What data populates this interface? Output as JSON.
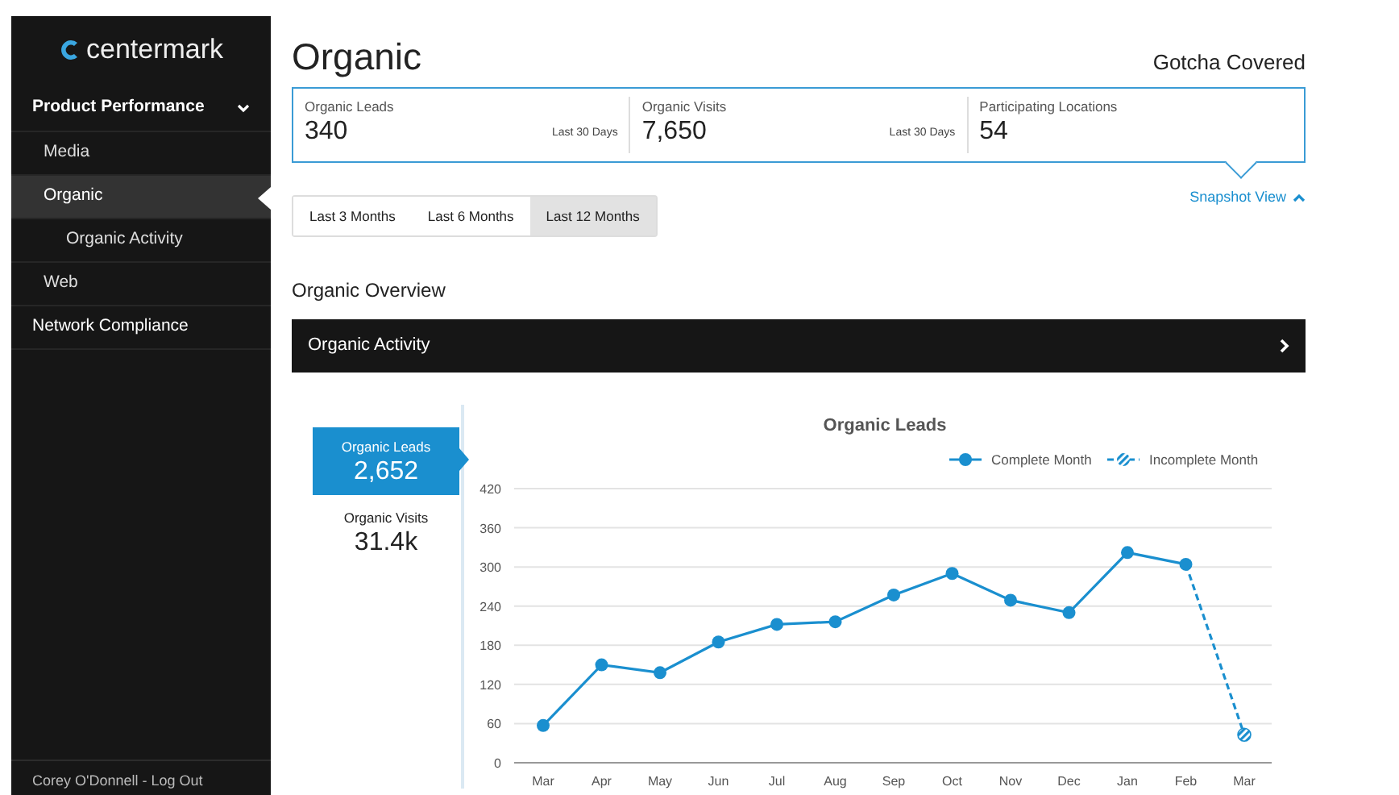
{
  "sidebar": {
    "logo": "centermark",
    "items": [
      {
        "label": "Product Performance",
        "expanded": true,
        "selected": false,
        "children": [
          {
            "label": "Media",
            "selected": false
          },
          {
            "label": "Organic",
            "selected": true,
            "children": [
              {
                "label": "Organic Activity",
                "selected": false
              }
            ]
          },
          {
            "label": "Web",
            "selected": false
          }
        ]
      },
      {
        "label": "Network Compliance",
        "selected": false
      }
    ],
    "user": "Corey O'Donnell - Log Out"
  },
  "page": {
    "title": "Organic",
    "account": "Gotcha Covered"
  },
  "metrics": [
    {
      "label": "Organic Leads",
      "value": "340",
      "period": "Last 30 Days"
    },
    {
      "label": "Organic Visits",
      "value": "7,650",
      "period": "Last 30 Days"
    },
    {
      "label": "Participating Locations",
      "value": "54"
    }
  ],
  "snapshot_toggle": {
    "label": "Snapshot View",
    "expanded": true
  },
  "ranges": [
    {
      "label": "Last 3 Months",
      "selected": false
    },
    {
      "label": "Last 6 Months",
      "selected": false
    },
    {
      "label": "Last 12 Months",
      "selected": true
    }
  ],
  "section_title": "Organic Overview",
  "activity_bar": {
    "label": "Organic Activity"
  },
  "side_metrics": [
    {
      "label": "Organic Leads",
      "value": "2,652",
      "selected": true
    },
    {
      "label": "Organic Visits",
      "value": "31.4k",
      "selected": false
    }
  ],
  "chart_data": {
    "type": "line",
    "title": "Organic Leads",
    "categories": [
      "Mar",
      "Apr",
      "May",
      "Jun",
      "Jul",
      "Aug",
      "Sep",
      "Oct",
      "Nov",
      "Dec",
      "Jan",
      "Feb",
      "Mar"
    ],
    "series": [
      {
        "name": "Complete Month",
        "color": "#1a8fcf",
        "marker": "circle",
        "line_style": "solid",
        "values": [
          57,
          150,
          138,
          185,
          212,
          216,
          257,
          290,
          249,
          230,
          322,
          304,
          null
        ]
      },
      {
        "name": "Incomplete Month",
        "color": "#1a8fcf",
        "marker": "hatched-circle",
        "line_style": "dashed",
        "values": [
          null,
          null,
          null,
          null,
          null,
          null,
          null,
          null,
          null,
          null,
          null,
          304,
          43
        ]
      }
    ],
    "grid": true,
    "legend": true,
    "ylim": [
      0,
      420
    ],
    "yticks": [
      0,
      60,
      120,
      180,
      240,
      300,
      360,
      420
    ]
  }
}
